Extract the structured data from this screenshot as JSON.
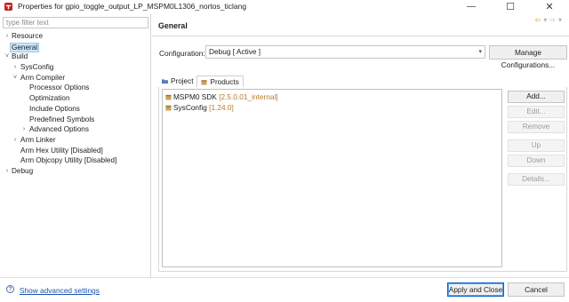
{
  "window": {
    "title": "Properties for gpio_toggle_output_LP_MSPM0L1306_nortos_ticlang",
    "minimize_glyph": "—",
    "maximize_glyph": "☐",
    "close_glyph": "✕"
  },
  "filter": {
    "placeholder": "type filter text",
    "value": ""
  },
  "tree": {
    "items": [
      {
        "label": "Resource",
        "chevron": "›"
      },
      {
        "label": "General",
        "selected": true
      },
      {
        "label": "Build",
        "chevron": "˅"
      },
      {
        "label": "SysConfig",
        "chevron": "›"
      },
      {
        "label": "Arm Compiler",
        "chevron": "˅"
      },
      {
        "label": "Processor Options"
      },
      {
        "label": "Optimization"
      },
      {
        "label": "Include Options"
      },
      {
        "label": "Predefined Symbols"
      },
      {
        "label": "Advanced Options",
        "chevron": "›"
      },
      {
        "label": "Arm Linker",
        "chevron": "›"
      },
      {
        "label": "Arm Hex Utility  [Disabled]"
      },
      {
        "label": "Arm Objcopy Utility  [Disabled]"
      },
      {
        "label": "Debug",
        "chevron": "›"
      }
    ]
  },
  "header": {
    "title": "General",
    "back_glyph": "⇦",
    "forward_glyph": "⇨",
    "dropdown_glyph": "▾"
  },
  "configuration": {
    "label": "Configuration:",
    "selected": "Debug  [ Active ]",
    "manage_label": "Manage Configurations..."
  },
  "tabs": [
    {
      "label": "Project",
      "active": false
    },
    {
      "label": "Products",
      "active": true
    }
  ],
  "products": [
    {
      "name": "MSPM0 SDK",
      "version": "[2.5.0.01_internal]"
    },
    {
      "name": "SysConfig",
      "version": "[1.24.0]"
    }
  ],
  "side_buttons": {
    "add": "Add...",
    "edit": "Edit...",
    "remove": "Remove",
    "up": "Up",
    "down": "Down",
    "details": "Details..."
  },
  "footer": {
    "help_glyph": "?",
    "advanced_link": "Show advanced settings",
    "apply_close": "Apply and Close",
    "cancel": "Cancel"
  },
  "colors": {
    "accent_blue": "#0a64c8",
    "selection": "#cce4f7",
    "version_text": "#b07a30",
    "link": "#1a54b0"
  }
}
